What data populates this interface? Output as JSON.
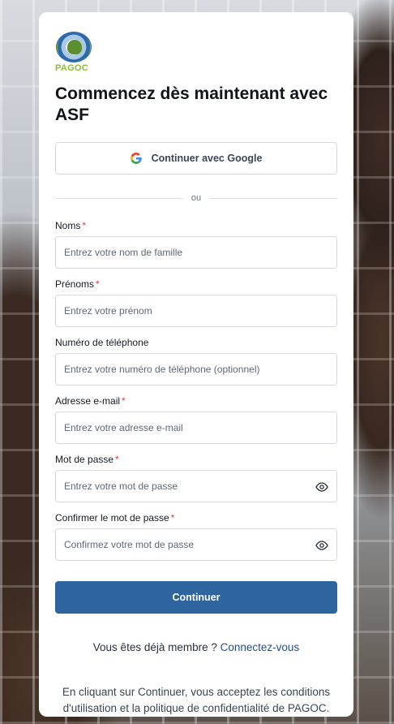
{
  "logo": {
    "text": "PAGOC"
  },
  "heading": "Commencez dès maintenant avec ASF",
  "google": {
    "label": "Continuer avec Google",
    "icon": "google-icon"
  },
  "divider": {
    "text": "ou"
  },
  "fields": {
    "nom": {
      "label": "Noms",
      "required": "*",
      "placeholder": "Entrez votre nom de famille",
      "value": ""
    },
    "prenom": {
      "label": "Prénoms",
      "required": "*",
      "placeholder": "Entrez votre prénom",
      "value": ""
    },
    "phone": {
      "label": "Numéro de téléphone",
      "placeholder": "Entrez votre numéro de téléphone (optionnel)",
      "value": ""
    },
    "email": {
      "label": "Adresse e-mail",
      "required": "*",
      "placeholder": "Entrez votre adresse e-mail",
      "value": ""
    },
    "password": {
      "label": "Mot de passe",
      "required": "*",
      "placeholder": "Entrez votre mot de passe",
      "value": "",
      "icon": "eye-icon"
    },
    "confirm": {
      "label": "Confirmer le mot de passe",
      "required": "*",
      "placeholder": "Confirmez votre mot de passe",
      "value": "",
      "icon": "eye-icon"
    }
  },
  "submit": {
    "label": "Continuer"
  },
  "signin": {
    "prompt": "Vous êtes déjà membre ?",
    "link": "Connectez-vous"
  },
  "terms": "En cliquant sur Continuer, vous acceptez les conditions d'utilisation et la politique de confidentialité de PAGOC.",
  "colors": {
    "primary": "#2e659f",
    "required": "#e0384a",
    "logo_green": "#8cbd33"
  }
}
